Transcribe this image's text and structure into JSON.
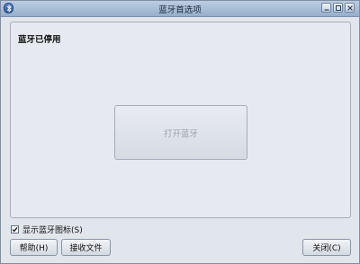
{
  "window": {
    "title": "蓝牙首选项",
    "icons": {
      "app": "bluetooth-icon",
      "minimize": "minimize-icon",
      "maximize": "maximize-icon",
      "close": "close-icon"
    }
  },
  "main": {
    "status_text": "蓝牙已停用",
    "enable_button_label": "打开蓝牙"
  },
  "options": {
    "show_icon_label": "显示蓝牙图标(S)",
    "show_icon_checked": true
  },
  "buttons": {
    "help": "帮助(H)",
    "receive": "接收文件",
    "close": "关闭(C)"
  }
}
